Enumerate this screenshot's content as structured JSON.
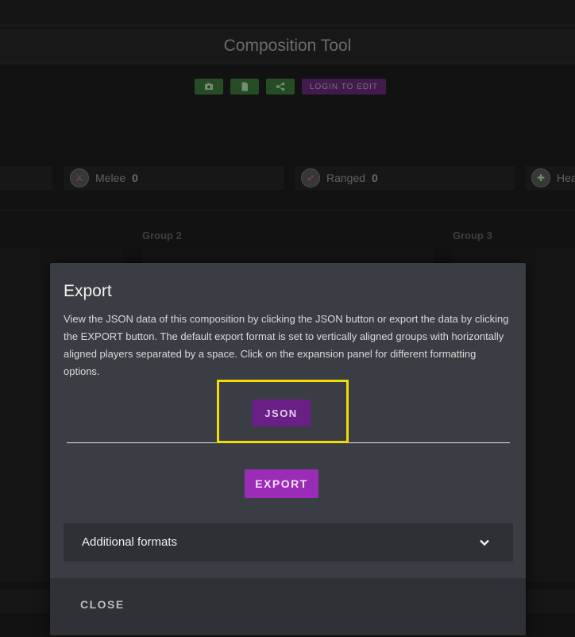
{
  "page": {
    "title": "Composition Tool",
    "login_label": "LOGIN TO EDIT"
  },
  "toolbar": {
    "icons": [
      "camera-icon",
      "file-icon",
      "share-icon"
    ]
  },
  "roles": [
    {
      "label": "Melee",
      "count": "0",
      "icon": "melee-icon"
    },
    {
      "label": "Ranged",
      "count": "0",
      "icon": "ranged-icon"
    },
    {
      "label": "Hea",
      "count": "",
      "icon": "healer-icon"
    }
  ],
  "groups": [
    "Group 2",
    "Group 3"
  ],
  "dialog": {
    "title": "Export",
    "description": "View the JSON data of this composition by clicking the JSON button or export the data by clicking the EXPORT button. The default export format is set to vertically aligned groups with horizontally aligned players separated by a space. Click on the expansion panel for different formatting options.",
    "json_label": "JSON",
    "export_label": "EXPORT",
    "expansion_label": "Additional formats",
    "close_label": "CLOSE"
  },
  "colors": {
    "highlight": "#f2dc05",
    "json_button": "#6a1f86",
    "export_button": "#9a2cb8",
    "toolbar_green": "#2e6a2b"
  }
}
